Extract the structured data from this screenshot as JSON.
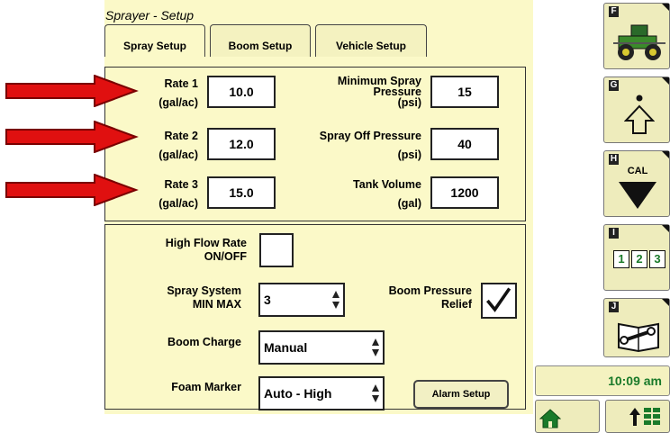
{
  "title": "Sprayer - Setup",
  "tabs": [
    "Spray Setup",
    "Boom Setup",
    "Vehicle Setup"
  ],
  "rates": [
    {
      "label": "Rate 1",
      "unit": "(gal/ac)",
      "value": "10.0"
    },
    {
      "label": "Rate 2",
      "unit": "(gal/ac)",
      "value": "12.0"
    },
    {
      "label": "Rate 3",
      "unit": "(gal/ac)",
      "value": "15.0"
    }
  ],
  "min_pressure": {
    "line1": "Minimum Spray",
    "line2": "Pressure",
    "unit": "(psi)",
    "value": "15"
  },
  "off_pressure": {
    "line1": "Spray Off Pressure",
    "unit": "(psi)",
    "value": "40"
  },
  "tank": {
    "line1": "Tank Volume",
    "unit": "(gal)",
    "value": "1200"
  },
  "high_flow": {
    "line1": "High Flow Rate",
    "line2": "ON/OFF",
    "checked": false
  },
  "min_max": {
    "line1": "Spray System",
    "line2": "MIN MAX",
    "value": "3"
  },
  "boom_charge": {
    "label": "Boom Charge",
    "value": "Manual"
  },
  "foam_marker": {
    "label": "Foam Marker",
    "value": "Auto - High"
  },
  "boom_relief": {
    "line1": "Boom Pressure",
    "line2": "Relief",
    "checked": true
  },
  "alarm_button": "Alarm Setup",
  "softkeys": {
    "f": "F",
    "g": "G",
    "h": "H",
    "i": "I",
    "j": "J",
    "cal": "CAL",
    "digits": [
      "1",
      "2",
      "3"
    ]
  },
  "clock": "10:09 am",
  "colors": {
    "screen": "#fbf9c8",
    "arrow": "#e01010",
    "clock_text": "#1a7a2a"
  }
}
